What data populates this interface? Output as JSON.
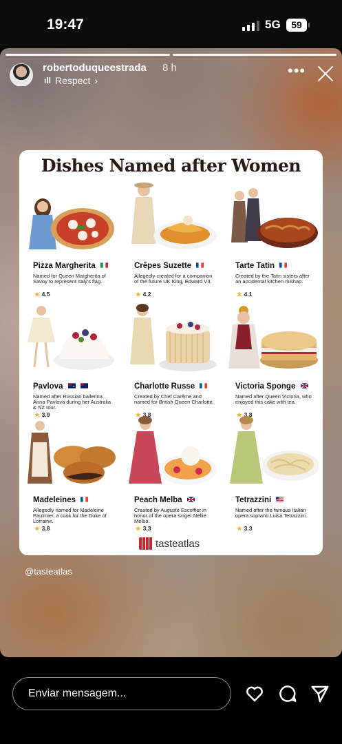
{
  "status": {
    "time": "19:47",
    "network": "5G",
    "battery": "59"
  },
  "story": {
    "username": "robertoduqueestrada",
    "time_ago": "8 h",
    "audio_label": "Respect",
    "handle": "@tasteatlas"
  },
  "card": {
    "title": "Dishes Named after Women",
    "brand": "tasteatlas",
    "dishes": [
      {
        "name": "Pizza Margherita",
        "desc": "Named for Queen Margherita of Savoy to represent Italy's flag.",
        "rating": "4.5",
        "flag": "it"
      },
      {
        "name": "Crêpes Suzette",
        "desc": "Allegedly created for a companion of the future UK King, Edward VII.",
        "rating": "4.2",
        "flag": "fr"
      },
      {
        "name": "Tarte Tatin",
        "desc": "Created by the Tatin sisters after an accidental kitchen mishap.",
        "rating": "4.1",
        "flag": "fr"
      },
      {
        "name": "Pavlova",
        "desc": "Named after Russian ballerina Anna Pavlova during her Australia & NZ tour.",
        "rating": "3.9",
        "flag": "au"
      },
      {
        "name": "Charlotte Russe",
        "desc": "Created by Chef Carême and named for British Queen Charlotte.",
        "rating": "3.8",
        "flag": "fr"
      },
      {
        "name": "Victoria Sponge",
        "desc": "Named after Queen Victoria, who enjoyed this cake with tea.",
        "rating": "3.8",
        "flag": "uk"
      },
      {
        "name": "Madeleines",
        "desc": "Allegedly named for Madeleine Paulmier, a cook for the Duke of Lorraine.",
        "rating": "3.8",
        "flag": "fr"
      },
      {
        "name": "Peach Melba",
        "desc": "Created by Auguste Escoffier in honor of the opera singer Nellie Melba.",
        "rating": "3.3",
        "flag": "uk"
      },
      {
        "name": "Tetrazzini",
        "desc": "Named after the famous Italian opera soprano Luisa Tetrazzini.",
        "rating": "3.3",
        "flag": "us"
      }
    ]
  },
  "footer": {
    "message_placeholder": "Enviar mensagem..."
  }
}
